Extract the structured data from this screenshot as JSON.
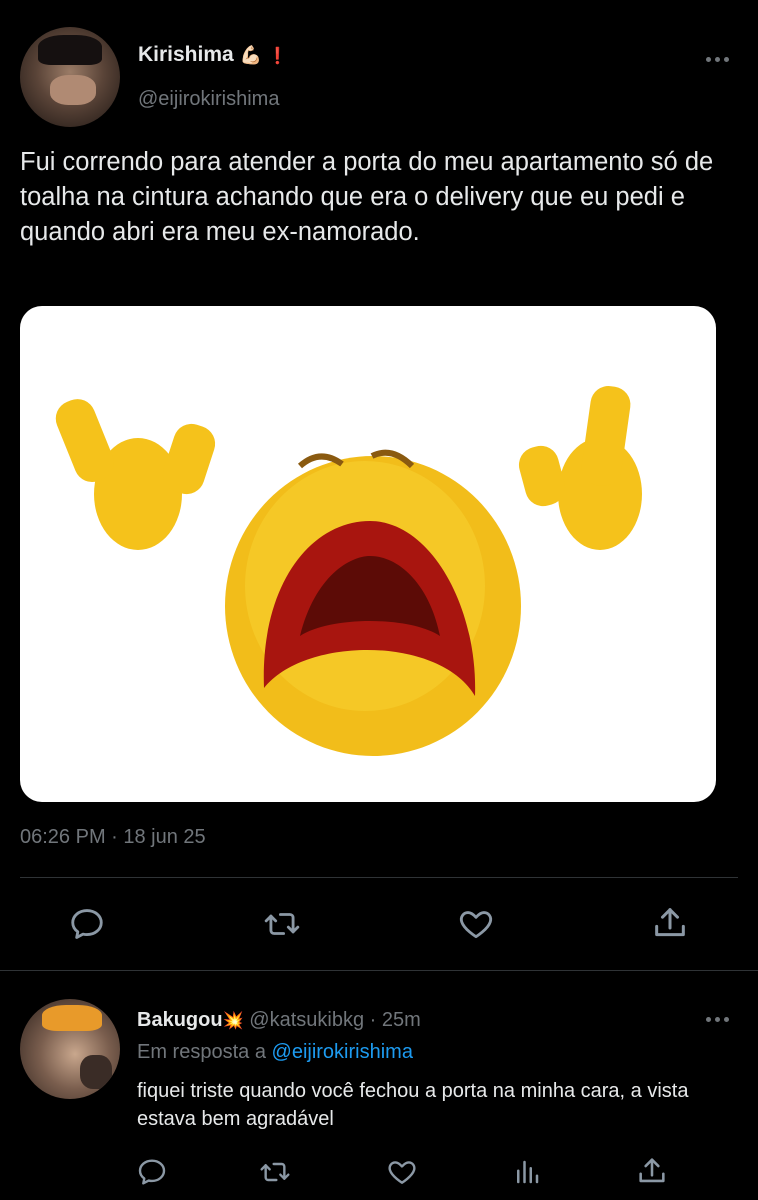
{
  "tweet": {
    "author_name": "Kirishima",
    "author_emoji": "💪🏻",
    "author_mark": "❗",
    "author_handle": "@eijirokirishima",
    "text": "Fui correndo para atender a porta do meu apartamento só de toalha na cintura achando que era o delivery que eu pedi e quando abri era meu ex-namorado.",
    "timestamp": "06:26 PM · 18 jun 25",
    "actions": [
      "reply-icon",
      "retweet-icon",
      "like-icon",
      "share-icon"
    ]
  },
  "reply": {
    "author_name": "Bakugou",
    "author_emoji": "💥",
    "author_handle": "@katsukibkg",
    "separator": "·",
    "time": "25m",
    "reply_prefix": "Em resposta a",
    "reply_to": "@eijirokirishima",
    "text": "fiquei triste quando você fechou a porta na minha cara, a vista estava bem agradável",
    "actions": [
      "reply-icon",
      "retweet-icon",
      "like-icon",
      "analytics-icon",
      "share-icon"
    ]
  },
  "colors": {
    "background": "#000000",
    "text": "#e7e9ea",
    "muted": "#71767b",
    "link": "#1d9bf0",
    "emoji_yellow": "#f5c21b"
  }
}
